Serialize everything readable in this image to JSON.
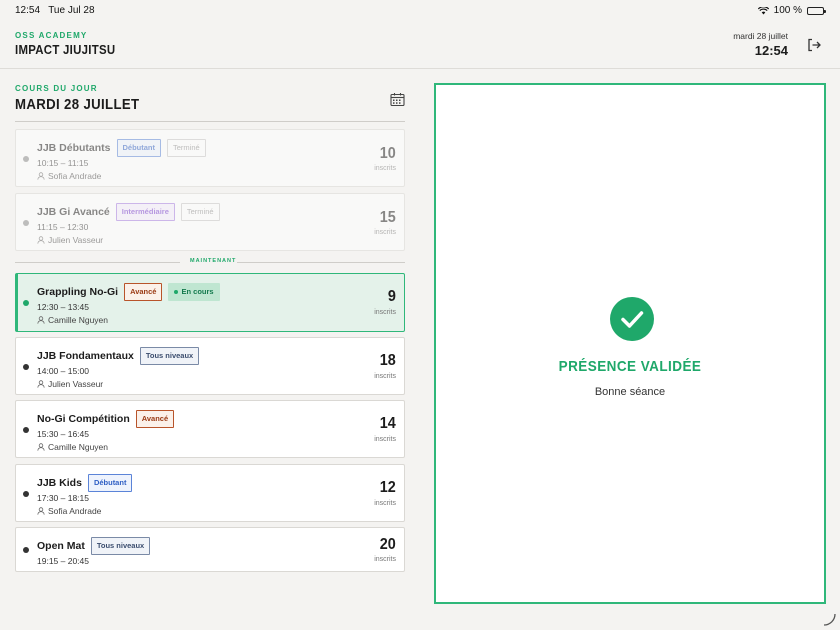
{
  "status_bar": {
    "time": "12:54",
    "date": "Tue Jul 28",
    "battery": "100 %"
  },
  "header": {
    "academy_label": "OSS ACADEMY",
    "academy_name": "IMPACT JIUJITSU",
    "date": "mardi 28 juillet",
    "time": "12:54",
    "logout_icon": "logout-icon"
  },
  "schedule": {
    "section_label": "COURS DU JOUR",
    "section_title": "MARDI 28 JUILLET",
    "now_label": "MAINTENANT",
    "count_unit": "inscrits",
    "classes": [
      {
        "name": "JJB Débutants",
        "level": "Débutant",
        "status": "Terminé",
        "time": "10:15 – 11:15",
        "coach": "Sofia Andrade",
        "count": "10"
      },
      {
        "name": "JJB Gi Avancé",
        "level": "Intermédiaire",
        "status": "Terminé",
        "time": "11:15 – 12:30",
        "coach": "Julien Vasseur",
        "count": "15"
      },
      {
        "name": "Grappling No-Gi",
        "level": "Avancé",
        "status": "En cours",
        "time": "12:30 – 13:45",
        "coach": "Camille Nguyen",
        "count": "9"
      },
      {
        "name": "JJB Fondamentaux",
        "level": "Tous niveaux",
        "time": "14:00 – 15:00",
        "coach": "Julien Vasseur",
        "count": "18"
      },
      {
        "name": "No-Gi Compétition",
        "level": "Avancé",
        "time": "15:30 – 16:45",
        "coach": "Camille Nguyen",
        "count": "14"
      },
      {
        "name": "JJB Kids",
        "level": "Débutant",
        "time": "17:30 – 18:15",
        "coach": "Sofia Andrade",
        "count": "12"
      },
      {
        "name": "Open Mat",
        "level": "Tous niveaux",
        "time": "19:15 – 20:45",
        "count": "20"
      }
    ]
  },
  "confirmation": {
    "title": "PRÉSENCE VALIDÉE",
    "subtitle": "Bonne séance"
  },
  "colors": {
    "accent": "#1fa86a",
    "current_bg": "#e4f2ea"
  }
}
